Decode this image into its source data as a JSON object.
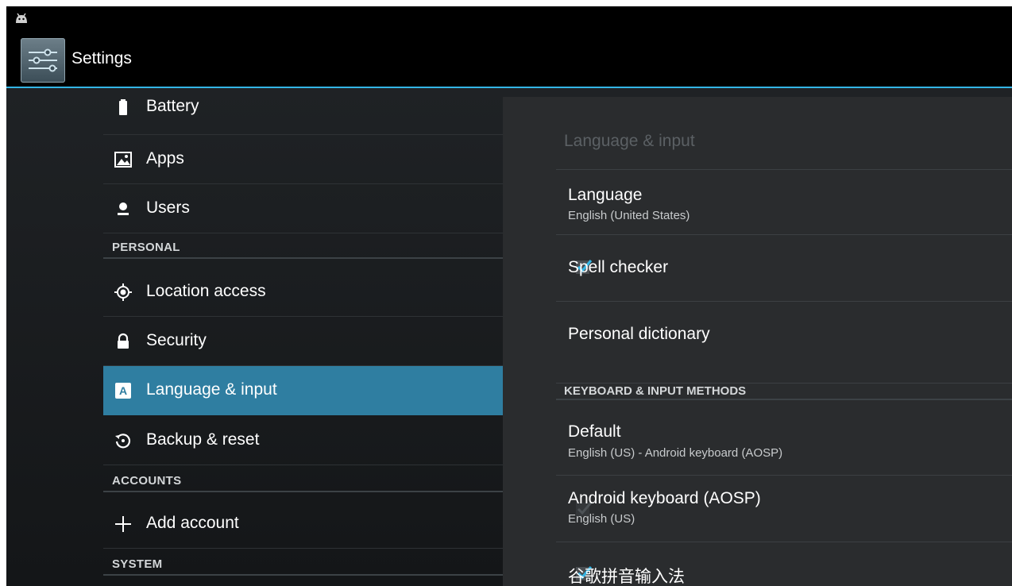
{
  "app": {
    "title": "Settings"
  },
  "sidebar": {
    "items_top": [
      {
        "label": "Battery",
        "icon": "battery-icon"
      },
      {
        "label": "Apps",
        "icon": "apps-icon"
      },
      {
        "label": "Users",
        "icon": "users-icon"
      }
    ],
    "personal_header": "PERSONAL",
    "personal_items": [
      {
        "label": "Location access",
        "icon": "location-icon"
      },
      {
        "label": "Security",
        "icon": "lock-icon"
      },
      {
        "label": "Language & input",
        "icon": "language-icon",
        "selected": true
      },
      {
        "label": "Backup & reset",
        "icon": "backup-icon"
      }
    ],
    "accounts_header": "ACCOUNTS",
    "accounts_items": [
      {
        "label": "Add account",
        "icon": "plus-icon"
      }
    ],
    "system_header": "SYSTEM"
  },
  "detail": {
    "title": "Language & input",
    "language": {
      "title": "Language",
      "summary": "English (United States)"
    },
    "spell_checker": {
      "title": "Spell checker",
      "checked": true
    },
    "personal_dictionary": {
      "title": "Personal dictionary"
    },
    "keyboard_header": "KEYBOARD & INPUT METHODS",
    "default": {
      "title": "Default",
      "summary": "English (US) - Android keyboard (AOSP)"
    },
    "android_keyboard": {
      "title": "Android keyboard (AOSP)",
      "summary": "English (US)",
      "checked": true,
      "enabled": false
    },
    "pinyin": {
      "title": "谷歌拼音输入法",
      "checked": true
    }
  },
  "colors": {
    "accent": "#33b5e5",
    "selected_bg": "#2f7ea1",
    "checkmark": "#33b5e5"
  }
}
